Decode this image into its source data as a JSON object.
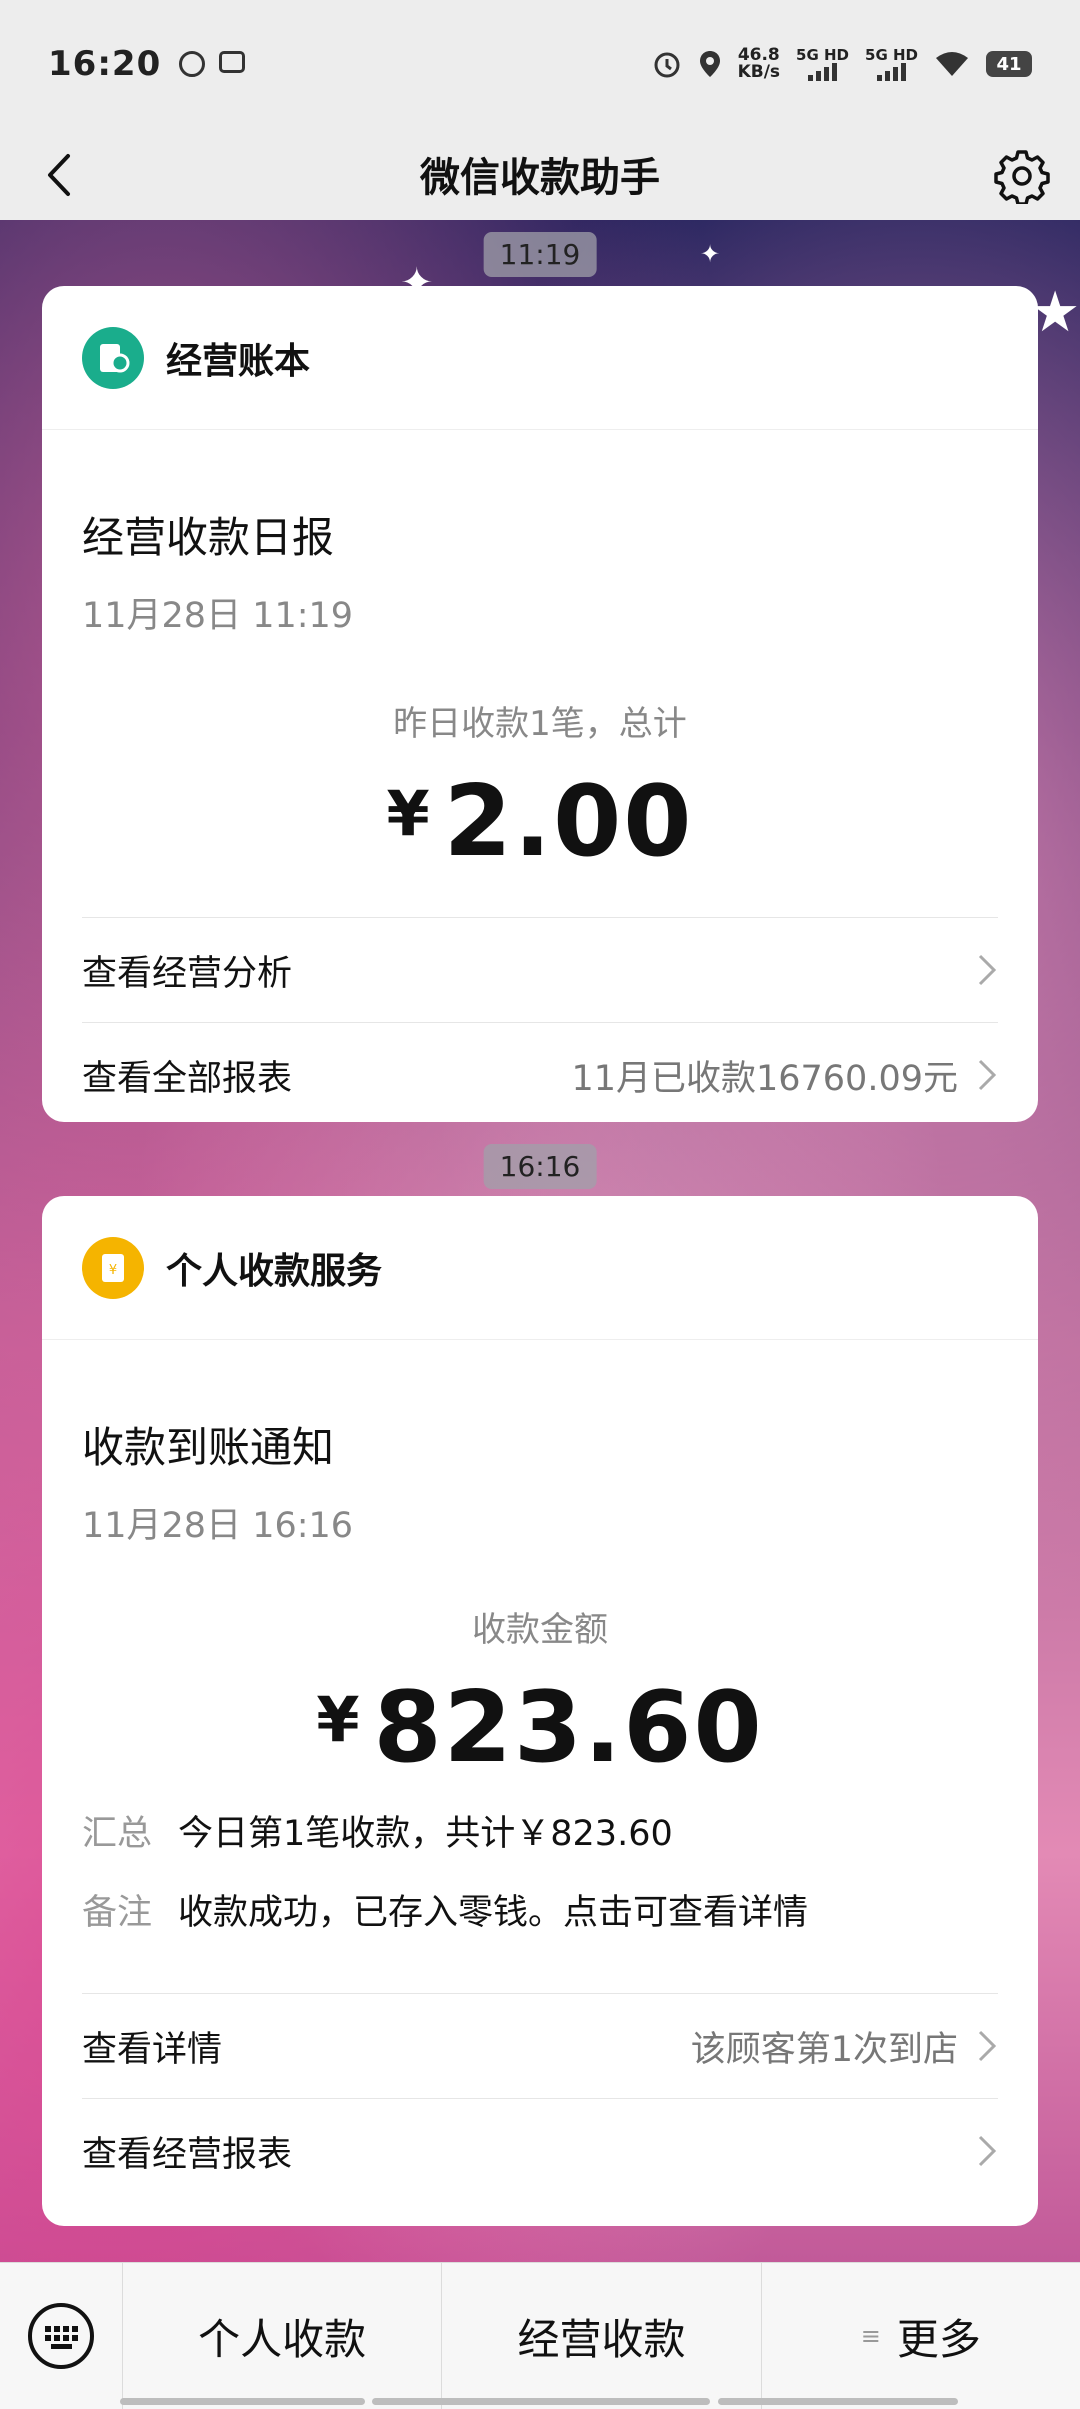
{
  "status_bar": {
    "time": "16:20",
    "net_speed_value": "46.8",
    "net_speed_unit": "KB/s",
    "sim1": "5G HD",
    "sim2": "5G HD",
    "battery": "41"
  },
  "header": {
    "title": "微信收款助手"
  },
  "messages": [
    {
      "timestamp": "11:19",
      "brand": "经营账本",
      "brand_color": "#1aad8c",
      "title": "经营收款日报",
      "date": "11月28日 11:19",
      "amount_label": "昨日收款1笔，总计",
      "currency": "¥",
      "amount": "2.00",
      "rows": [
        {
          "label": "查看经营分析",
          "extra": ""
        },
        {
          "label": "查看全部报表",
          "extra": "11月已收款16760.09元"
        }
      ]
    },
    {
      "timestamp": "16:16",
      "brand": "个人收款服务",
      "brand_color": "#f5b400",
      "title": "收款到账通知",
      "date": "11月28日 16:16",
      "amount_label": "收款金额",
      "currency": "¥",
      "amount": "823.60",
      "summary_key": "汇总",
      "summary_value": "今日第1笔收款，共计￥823.60",
      "note_key": "备注",
      "note_value": "收款成功，已存入零钱。点击可查看详情",
      "rows": [
        {
          "label": "查看详情",
          "extra": "该顾客第1次到店"
        },
        {
          "label": "查看经营报表",
          "extra": ""
        }
      ]
    }
  ],
  "bottom_menu": {
    "items": [
      "个人收款",
      "经营收款",
      "更多"
    ]
  }
}
